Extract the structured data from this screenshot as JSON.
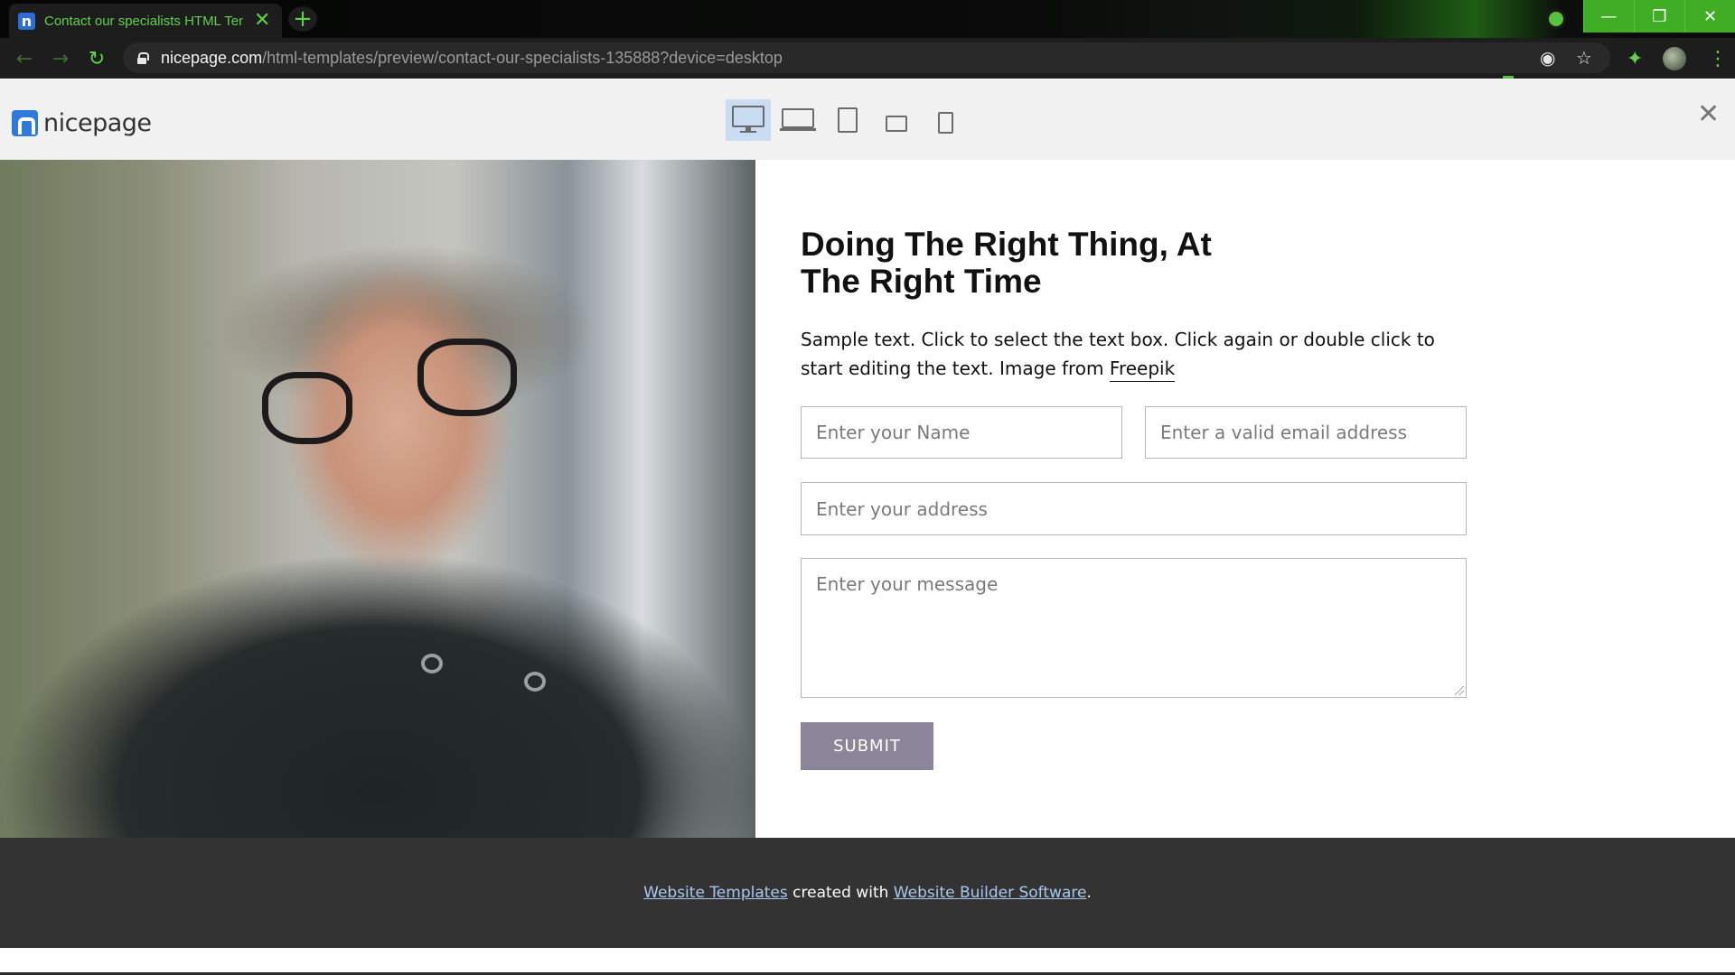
{
  "browser": {
    "tab_title": "Contact our specialists HTML Ten",
    "tab_favicon": "n",
    "tab_close": "✕",
    "new_tab": "+",
    "url_host": "nicepage.com",
    "url_path": "/html-templates/preview/contact-our-specialists-135888?device=desktop",
    "window_buttons": {
      "minimize": "—",
      "restore": "❐",
      "close": "✕"
    },
    "accent_color": "#3fae25"
  },
  "preview_header": {
    "logo_text": "nicepage",
    "devices": [
      "desktop",
      "laptop",
      "tablet",
      "tablet-landscape",
      "phone"
    ],
    "active_device": "desktop",
    "close": "✕"
  },
  "contact": {
    "title": "Doing The Right Thing, At The Right Time",
    "description": "Sample text. Click to select the text box. Click again or double click to start editing the text. Image from ",
    "link_text": "Freepik",
    "form": {
      "name_placeholder": "Enter your Name",
      "email_placeholder": "Enter a valid email address",
      "address_placeholder": "Enter your address",
      "message_placeholder": "Enter your message",
      "submit_label": "SUBMIT"
    },
    "submit_color": "#8a8598"
  },
  "footer": {
    "link1": "Website Templates",
    "middle": " created with ",
    "link2": "Website Builder Software",
    "end": "."
  }
}
